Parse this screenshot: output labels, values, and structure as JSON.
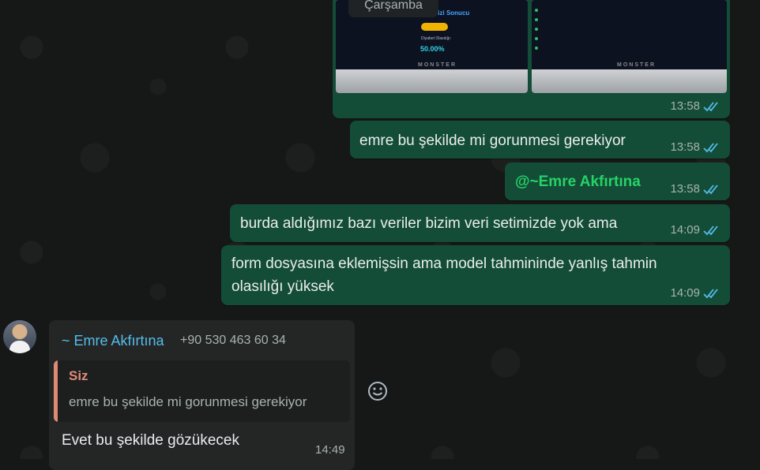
{
  "date_divider": "Çarşamba",
  "photo_message": {
    "time": "13:58",
    "status": "read",
    "left_screen": {
      "title": "Diyabet Risk Analizi Sonucu",
      "probability_label": "Diyabet Olasılığı:",
      "probability_value": "50.00%",
      "laptop_brand": "MONSTER"
    },
    "right_screen": {
      "laptop_brand": "MONSTER"
    }
  },
  "outgoing_messages": [
    {
      "text": "emre bu şekilde mi gorunmesi gerekiyor",
      "time": "13:58",
      "status": "read"
    },
    {
      "text": "@~Emre Akfırtına",
      "time": "13:58",
      "status": "read",
      "is_mention": true
    },
    {
      "text": "burda aldığımız bazı veriler bizim veri setimizde yok ama",
      "time": "14:09",
      "status": "read"
    },
    {
      "text_line1": "form dosyasına eklemişsin ama model tahmininde yanlış tahmin",
      "text_line2": "olasılığı yüksek",
      "time": "14:09",
      "status": "read"
    }
  ],
  "incoming_message": {
    "sender_name": "~ Emre Akfırtına",
    "sender_phone": "+90 530 463 60 34",
    "quoted": {
      "author": "Siz",
      "text": "emre bu şekilde mi gorunmesi gerekiyor"
    },
    "text": "Evet bu şekilde gözükecek",
    "time": "14:49"
  },
  "icons": {
    "read_receipt": "double-check-icon",
    "reaction": "emoji-smile-icon"
  },
  "colors": {
    "background": "#161717",
    "outgoing_bubble": "#144d37",
    "incoming_bubble": "#242626",
    "read_ticks": "#53bdeb",
    "mention": "#25d366",
    "sender_name": "#53bdeb",
    "quote_accent": "#e08a76"
  }
}
